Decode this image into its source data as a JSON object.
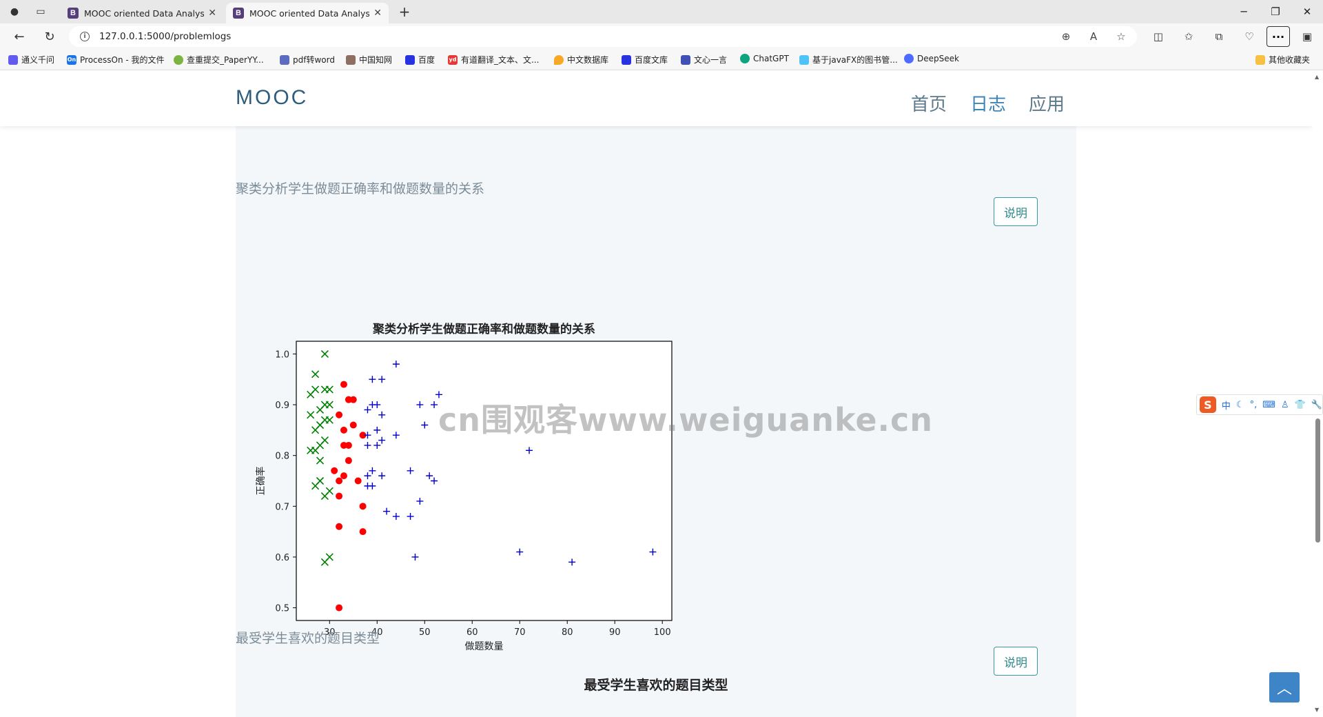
{
  "browser": {
    "tabs": [
      {
        "title": "MOOC oriented Data Analysis Sys",
        "favicon": "B"
      },
      {
        "title": "MOOC oriented Data Analysis Sys",
        "favicon": "B"
      }
    ],
    "url": "127.0.0.1:5000/problemlogs",
    "bookmarks": [
      "通义千问",
      "ProcessOn - 我的文件",
      "查重提交_PaperYY...",
      "pdf转word",
      "中国知网",
      "百度",
      "有道翻译_文本、文...",
      "中文数据库",
      "百度文库",
      "文心一言",
      "ChatGPT",
      "基于javaFX的图书管...",
      "DeepSeek"
    ],
    "other_bookmarks": "其他收藏夹"
  },
  "navbar": {
    "brand": "MOOC",
    "links": [
      "首页",
      "日志",
      "应用"
    ],
    "active_link": "日志"
  },
  "sections": [
    {
      "title": "聚类分析学生做题正确率和做题数量的关系",
      "button": "说明"
    },
    {
      "title": "最受学生喜欢的题目类型",
      "button": "说明"
    }
  ],
  "chart2_title": "最受学生喜欢的题目类型",
  "watermark": "cn围观客www.weiguanke.cn",
  "ime": {
    "mode": "中"
  },
  "chart_data": {
    "type": "scatter",
    "title": "聚类分析学生做题正确率和做题数量的关系",
    "xlabel": "做题数量",
    "ylabel": "正确率",
    "xlim": [
      23,
      102
    ],
    "ylim": [
      0.475,
      1.025
    ],
    "xticks": [
      30,
      40,
      50,
      60,
      70,
      80,
      90,
      100
    ],
    "yticks": [
      0.5,
      0.6,
      0.7,
      0.8,
      0.9,
      1.0
    ],
    "grid": false,
    "series": [
      {
        "marker": "x",
        "color": "#008000",
        "points": [
          [
            29,
            1.0
          ],
          [
            27,
            0.96
          ],
          [
            26,
            0.92
          ],
          [
            27,
            0.93
          ],
          [
            29,
            0.93
          ],
          [
            30,
            0.93
          ],
          [
            28,
            0.89
          ],
          [
            29,
            0.9
          ],
          [
            30,
            0.9
          ],
          [
            26,
            0.88
          ],
          [
            29,
            0.87
          ],
          [
            28,
            0.86
          ],
          [
            30,
            0.87
          ],
          [
            27,
            0.85
          ],
          [
            29,
            0.83
          ],
          [
            28,
            0.82
          ],
          [
            27,
            0.81
          ],
          [
            26,
            0.81
          ],
          [
            28,
            0.79
          ],
          [
            28,
            0.75
          ],
          [
            27,
            0.74
          ],
          [
            30,
            0.73
          ],
          [
            29,
            0.72
          ],
          [
            30,
            0.6
          ],
          [
            29,
            0.59
          ]
        ]
      },
      {
        "marker": "o",
        "color": "#ff0000",
        "points": [
          [
            33,
            0.94
          ],
          [
            34,
            0.91
          ],
          [
            35,
            0.91
          ],
          [
            32,
            0.88
          ],
          [
            35,
            0.86
          ],
          [
            33,
            0.85
          ],
          [
            37,
            0.84
          ],
          [
            33,
            0.82
          ],
          [
            34,
            0.82
          ],
          [
            34,
            0.79
          ],
          [
            31,
            0.77
          ],
          [
            33,
            0.76
          ],
          [
            32,
            0.75
          ],
          [
            36,
            0.75
          ],
          [
            32,
            0.72
          ],
          [
            37,
            0.7
          ],
          [
            32,
            0.66
          ],
          [
            37,
            0.65
          ],
          [
            32,
            0.5
          ]
        ]
      },
      {
        "marker": "+",
        "color": "#0000cc",
        "points": [
          [
            44,
            0.98
          ],
          [
            39,
            0.95
          ],
          [
            41,
            0.95
          ],
          [
            53,
            0.92
          ],
          [
            38,
            0.89
          ],
          [
            39,
            0.9
          ],
          [
            40,
            0.9
          ],
          [
            49,
            0.9
          ],
          [
            52,
            0.9
          ],
          [
            41,
            0.88
          ],
          [
            50,
            0.86
          ],
          [
            40,
            0.85
          ],
          [
            38,
            0.84
          ],
          [
            44,
            0.84
          ],
          [
            41,
            0.83
          ],
          [
            38,
            0.82
          ],
          [
            40,
            0.82
          ],
          [
            72,
            0.81
          ],
          [
            39,
            0.77
          ],
          [
            47,
            0.77
          ],
          [
            38,
            0.76
          ],
          [
            41,
            0.76
          ],
          [
            51,
            0.76
          ],
          [
            52,
            0.75
          ],
          [
            38,
            0.74
          ],
          [
            39,
            0.74
          ],
          [
            49,
            0.71
          ],
          [
            42,
            0.69
          ],
          [
            44,
            0.68
          ],
          [
            47,
            0.68
          ],
          [
            70,
            0.61
          ],
          [
            98,
            0.61
          ],
          [
            48,
            0.6
          ],
          [
            81,
            0.59
          ]
        ]
      }
    ]
  }
}
